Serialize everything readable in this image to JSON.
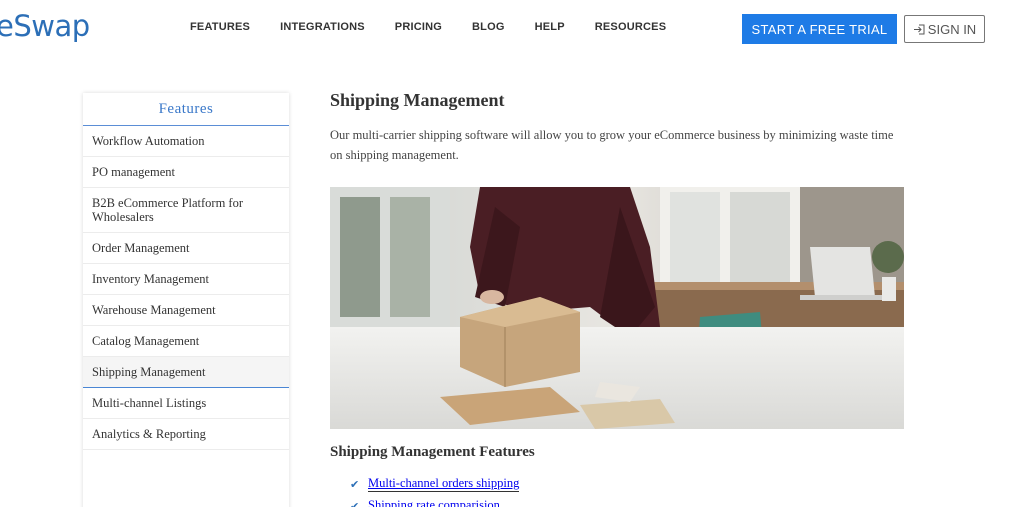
{
  "header": {
    "logo": "eSwap",
    "nav": [
      "FEATURES",
      "INTEGRATIONS",
      "PRICING",
      "BLOG",
      "HELP",
      "RESOURCES"
    ],
    "trial_label": "START A FREE TRIAL",
    "signin_label": "SIGN IN",
    "accent": "#1e7be6"
  },
  "sidebar": {
    "title": "Features",
    "items": [
      "Workflow Automation",
      "PO management",
      "B2B eCommerce Platform for Wholesalers",
      "Order Management",
      "Inventory Management",
      "Warehouse Management",
      "Catalog Management",
      "Shipping Management",
      "Multi-channel Listings",
      "Analytics & Reporting"
    ],
    "active_item": "Shipping Management"
  },
  "main": {
    "title": "Shipping Management",
    "intro": "Our multi-carrier shipping software will allow you to grow your eCommerce business by minimizing waste time on shipping management.",
    "features_title": "Shipping Management Features",
    "features": [
      "Multi-channel orders shipping",
      "Shipping rate comparision"
    ]
  }
}
